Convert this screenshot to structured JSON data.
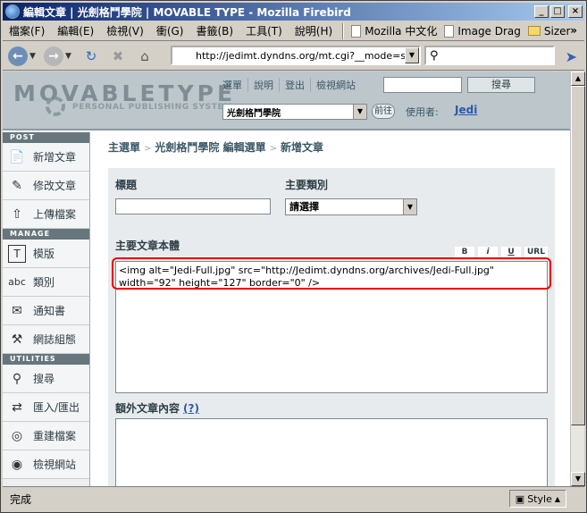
{
  "window": {
    "title": "編輯文章 | 光劍格鬥學院 | MOVABLE TYPE - Mozilla Firebird"
  },
  "menubar": {
    "items": [
      "檔案(F)",
      "編輯(E)",
      "檢視(V)",
      "衝(G)",
      "書籤(B)",
      "工具(T)",
      "說明(H)"
    ],
    "bookmarks": [
      "Mozilla 中文化",
      "Image Drag",
      "Sizer"
    ],
    "more": "»"
  },
  "navbar": {
    "url": "http://jedimt.dyndns.org/mt.cgi?__mode=start_uplo",
    "search_placeholder": ""
  },
  "mt": {
    "logo_text": "MOVABLETYPE",
    "tagline": "PERSONAL PUBLISHING SYSTEM",
    "top_links": [
      "選單",
      "說明",
      "登出",
      "檢視網站"
    ],
    "search_button": "搜尋",
    "blog_select": "光劍格鬥學院",
    "go_button": "前往",
    "user_label": "使用者:",
    "user_name": "Jedi"
  },
  "sidebar": {
    "sections": [
      {
        "title": "POST",
        "items": [
          {
            "label": "新增文章",
            "icon": "page-icon"
          },
          {
            "label": "修改文章",
            "icon": "edit-icon"
          },
          {
            "label": "上傳檔案",
            "icon": "upload-icon"
          }
        ]
      },
      {
        "title": "MANAGE",
        "items": [
          {
            "label": "模版",
            "icon": "template-icon"
          },
          {
            "label": "類別",
            "icon": "category-icon"
          },
          {
            "label": "通知書",
            "icon": "mail-icon"
          },
          {
            "label": "網誌組態",
            "icon": "tools-icon"
          }
        ]
      },
      {
        "title": "UTILITIES",
        "items": [
          {
            "label": "搜尋",
            "icon": "search-icon"
          },
          {
            "label": "匯入/匯出",
            "icon": "import-export-icon"
          },
          {
            "label": "重建檔案",
            "icon": "rebuild-icon"
          },
          {
            "label": "檢視網站",
            "icon": "view-site-icon"
          }
        ]
      }
    ]
  },
  "breadcrumb": {
    "items": [
      "主選單",
      "光劍格鬥學院 編輯選單"
    ],
    "current": "新增文章"
  },
  "form": {
    "title_label": "標題",
    "title_value": "",
    "category_label": "主要類別",
    "category_value": "請選擇",
    "body_label": "主要文章本體",
    "format_buttons": [
      "B",
      "i",
      "U",
      "URL"
    ],
    "body_value": "<img alt=\"Jedi-Full.jpg\" src=\"http://Jedimt.dyndns.org/archives/Jedi-Full.jpg\" width=\"92\" height=\"127\" border=\"0\" />",
    "extended_label": "額外文章內容",
    "extended_help": "(?)"
  },
  "statusbar": {
    "text": "完成",
    "style_label": "Style"
  }
}
